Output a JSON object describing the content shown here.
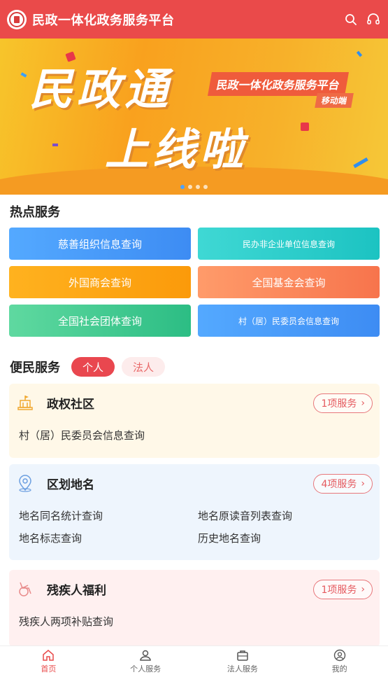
{
  "header": {
    "title": "民政一体化政务服务平台",
    "logo_icon": "emblem-logo-icon",
    "search_icon": "search-icon",
    "support_icon": "headset-icon",
    "bg_color": "#ea4a4a"
  },
  "banner": {
    "headline_1": "民政通",
    "headline_2": "上线啦",
    "ribbon_text": "民政一体化政务服务平台",
    "ribbon_sub": "移动端",
    "slide_count": 4,
    "active_slide": 1
  },
  "hot": {
    "title": "热点服务",
    "items": [
      {
        "label": "慈善组织信息查询",
        "color": "blue"
      },
      {
        "label": "民办非企业单位信息查询",
        "color": "teal"
      },
      {
        "label": "外国商会查询",
        "color": "orange"
      },
      {
        "label": "全国基金会查询",
        "color": "coral"
      },
      {
        "label": "全国社会团体查询",
        "color": "green"
      },
      {
        "label": "村（居）民委员会信息查询",
        "color": "blue"
      }
    ]
  },
  "convenience": {
    "title": "便民服务",
    "tabs": [
      {
        "label": "个人",
        "active": true
      },
      {
        "label": "法人",
        "active": false
      }
    ],
    "cards": [
      {
        "title": "政权社区",
        "icon": "government-building-icon",
        "count_label": "1项服务",
        "items": [
          "村（居）民委员会信息查询"
        ]
      },
      {
        "title": "区划地名",
        "icon": "map-pin-icon",
        "count_label": "4项服务",
        "items": [
          "地名同名统计查询",
          "地名原读音列表查询",
          "地名标志查询",
          "历史地名查询"
        ]
      },
      {
        "title": "残疾人福利",
        "icon": "wheelchair-icon",
        "count_label": "1项服务",
        "items": [
          "残疾人两项补贴查询"
        ]
      }
    ]
  },
  "nav": {
    "items": [
      {
        "label": "首页",
        "icon": "home-icon",
        "active": true
      },
      {
        "label": "个人服务",
        "icon": "person-icon",
        "active": false
      },
      {
        "label": "法人服务",
        "icon": "briefcase-icon",
        "active": false
      },
      {
        "label": "我的",
        "icon": "profile-icon",
        "active": false
      }
    ]
  }
}
